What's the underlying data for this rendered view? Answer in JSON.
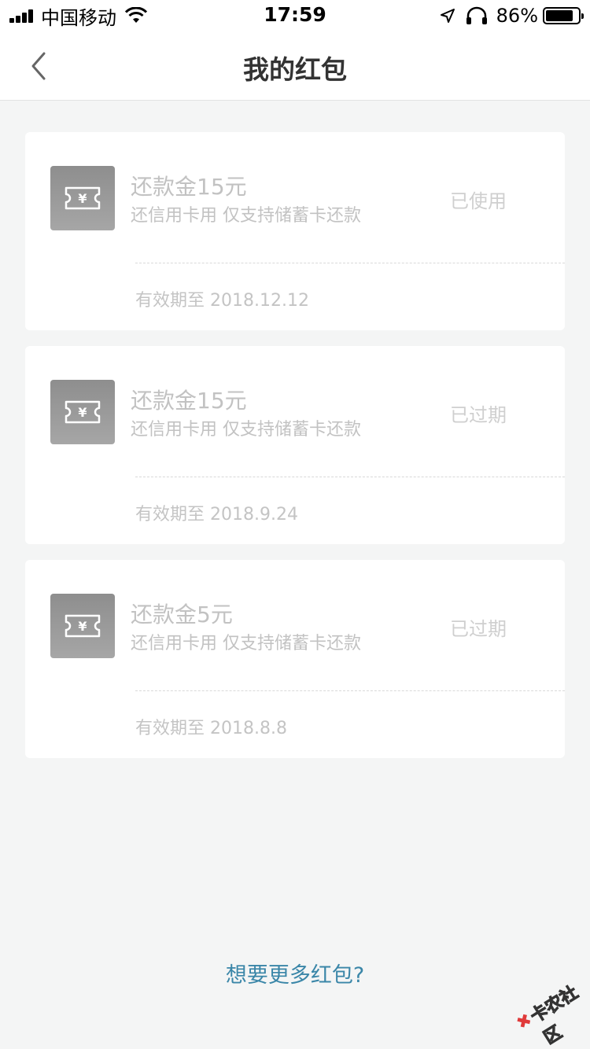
{
  "status_bar": {
    "carrier": "中国移动",
    "time": "17:59",
    "battery": "86%",
    "battery_level": 0.86
  },
  "nav": {
    "title": "我的红包"
  },
  "coupons": [
    {
      "title": "还款金15元",
      "desc": "还信用卡用 仅支持储蓄卡还款",
      "status": "已使用",
      "expiry": "有效期至 2018.12.12"
    },
    {
      "title": "还款金15元",
      "desc": "还信用卡用 仅支持储蓄卡还款",
      "status": "已过期",
      "expiry": "有效期至 2018.9.24"
    },
    {
      "title": "还款金5元",
      "desc": "还信用卡用 仅支持储蓄卡还款",
      "status": "已过期",
      "expiry": "有效期至 2018.8.8"
    }
  ],
  "footer": {
    "more_link": "想要更多红包?"
  },
  "watermark": {
    "text": "卡农社区"
  },
  "colors": {
    "accent_link": "#3a86a8",
    "muted_text": "#c2c2c2",
    "background": "#f4f5f5"
  }
}
